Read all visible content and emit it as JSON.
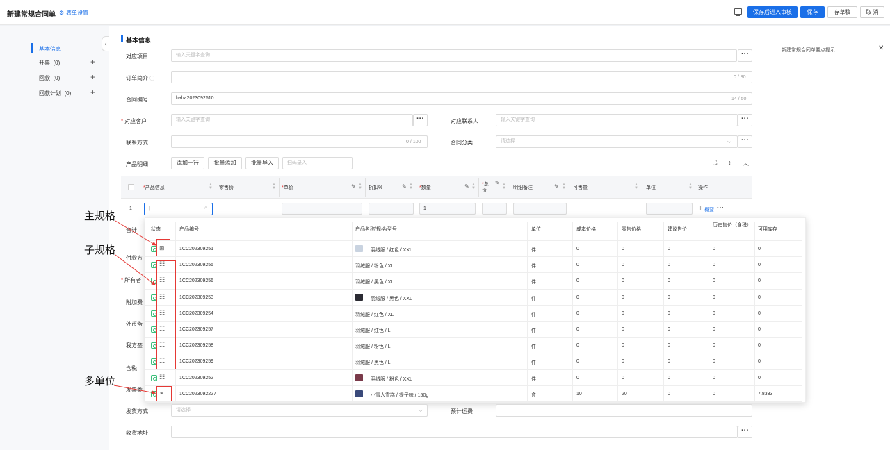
{
  "app": {
    "title": "新建常规合同单",
    "form_settings": "表单设置"
  },
  "toolbar": {
    "save_review": "保存后进入审核",
    "save": "保存",
    "draft": "存草稿",
    "cancel": "取 消"
  },
  "nav": {
    "items": [
      {
        "label": "基本信息"
      },
      {
        "label": "开票",
        "count": "(0)"
      },
      {
        "label": "回款",
        "count": "(0)"
      },
      {
        "label": "回款计划",
        "count": "(0)"
      }
    ]
  },
  "right_panel": {
    "tip": "新建常规合同单要点提示:"
  },
  "section": {
    "title": "基本信息"
  },
  "form": {
    "project_label": "对应项目",
    "project_ph": "输入关键字查询",
    "summary_label": "订单简介",
    "summary_counter": "0 / 80",
    "contract_no_label": "合同编号",
    "contract_no_value": "haha2023092510",
    "contract_no_counter": "14 / 50",
    "customer_label": "对应客户",
    "customer_ph": "输入关键字查询",
    "contact_label": "对应联系人",
    "contact_ph": "输入关键字查询",
    "phone_label": "联系方式",
    "phone_counter": "0 / 100",
    "category_label": "合同分类",
    "category_ph": "请选择",
    "products_label": "产品明细",
    "add_row": "添加一行",
    "batch_add": "批量添加",
    "batch_import": "批量导入",
    "scan_ph": "扫码录入",
    "ship_label": "发货方式",
    "ship_ph": "请选择",
    "freight_label": "预计运费",
    "address_label": "收货地址",
    "partial_labels": [
      "合计",
      "付款方",
      "所有者",
      "附加费",
      "外币备",
      "我方签",
      "含税",
      "发票类"
    ]
  },
  "grid": {
    "headers": [
      "产品信息",
      "零售价",
      "单价",
      "折扣%",
      "数量",
      "总价",
      "明细备注",
      "可售量",
      "单位",
      "操作"
    ],
    "row_no": "1",
    "qty": "1",
    "summary_link": "概要"
  },
  "popup": {
    "headers": [
      "状态",
      "产品编号",
      "产品名称/规格/型号",
      "单位",
      "成本价格",
      "零售价格",
      "建议售价",
      "历史售价（含税）",
      "可用库存"
    ],
    "rows": [
      {
        "code": "1CC202309251",
        "name": "羽绒服 / 红色 / XXL",
        "unit": "件",
        "cost": "0",
        "retail": "0",
        "suggest": "0",
        "history": "0",
        "stock": "0",
        "thumb": "#c9d3e0"
      },
      {
        "code": "1CC202309255",
        "name": "羽绒服 / 粉色 / XL",
        "unit": "件",
        "cost": "0",
        "retail": "0",
        "suggest": "0",
        "history": "0",
        "stock": "0",
        "thumb": ""
      },
      {
        "code": "1CC202309256",
        "name": "羽绒服 / 黑色 / XL",
        "unit": "件",
        "cost": "0",
        "retail": "0",
        "suggest": "0",
        "history": "0",
        "stock": "0",
        "thumb": ""
      },
      {
        "code": "1CC202309253",
        "name": "羽绒服 / 黑色 / XXL",
        "unit": "件",
        "cost": "0",
        "retail": "0",
        "suggest": "0",
        "history": "0",
        "stock": "0",
        "thumb": "#2b2b33"
      },
      {
        "code": "1CC202309254",
        "name": "羽绒服 / 红色 / XL",
        "unit": "件",
        "cost": "0",
        "retail": "0",
        "suggest": "0",
        "history": "0",
        "stock": "0",
        "thumb": ""
      },
      {
        "code": "1CC202309257",
        "name": "羽绒服 / 红色 / L",
        "unit": "件",
        "cost": "0",
        "retail": "0",
        "suggest": "0",
        "history": "0",
        "stock": "0",
        "thumb": ""
      },
      {
        "code": "1CC202309258",
        "name": "羽绒服 / 粉色 / L",
        "unit": "件",
        "cost": "0",
        "retail": "0",
        "suggest": "0",
        "history": "0",
        "stock": "0",
        "thumb": ""
      },
      {
        "code": "1CC202309259",
        "name": "羽绒服 / 黑色 / L",
        "unit": "件",
        "cost": "0",
        "retail": "0",
        "suggest": "0",
        "history": "0",
        "stock": "0",
        "thumb": ""
      },
      {
        "code": "1CC202309252",
        "name": "羽绒服 / 粉色 / XXL",
        "unit": "件",
        "cost": "0",
        "retail": "0",
        "suggest": "0",
        "history": "0",
        "stock": "0",
        "thumb": "#7a3a4a"
      },
      {
        "code": "1CC2023092227",
        "name": "小雪人雪糕 / 提子味 / 150g",
        "unit": "盒",
        "cost": "10",
        "retail": "20",
        "suggest": "0",
        "history": "0",
        "stock": "7.8333",
        "thumb": "#3a4a7a"
      }
    ]
  },
  "annotations": {
    "main_spec": "主规格",
    "sub_spec": "子规格",
    "multi_unit": "多单位"
  },
  "colors": {
    "primary": "#1a6fe8",
    "required": "#e53935",
    "status_green": "#3bbf7a",
    "annotation_red": "#e53935"
  }
}
